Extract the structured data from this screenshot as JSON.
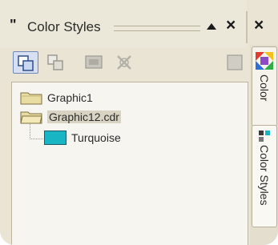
{
  "panel": {
    "title": "Color Styles"
  },
  "tree": {
    "items": [
      {
        "label": "Graphic1",
        "type": "folder"
      },
      {
        "label": "Graphic12.cdr",
        "type": "folder",
        "selected": true
      },
      {
        "label": "Turquoise",
        "type": "color",
        "color": "#18b6c4"
      }
    ]
  },
  "side_tabs": [
    {
      "label": "Color",
      "icon": "color-palette-icon"
    },
    {
      "label": "Color Styles",
      "icon": "color-styles-icon"
    }
  ],
  "toolbar": {
    "icons": [
      "new-style-icon",
      "new-child-icon",
      "convert-icon",
      "delete-icon",
      "options-icon"
    ]
  },
  "colors": {
    "accent": "#18b6c4",
    "panel_bg": "#e9e4d4",
    "tree_bg": "#f6f5f0"
  }
}
